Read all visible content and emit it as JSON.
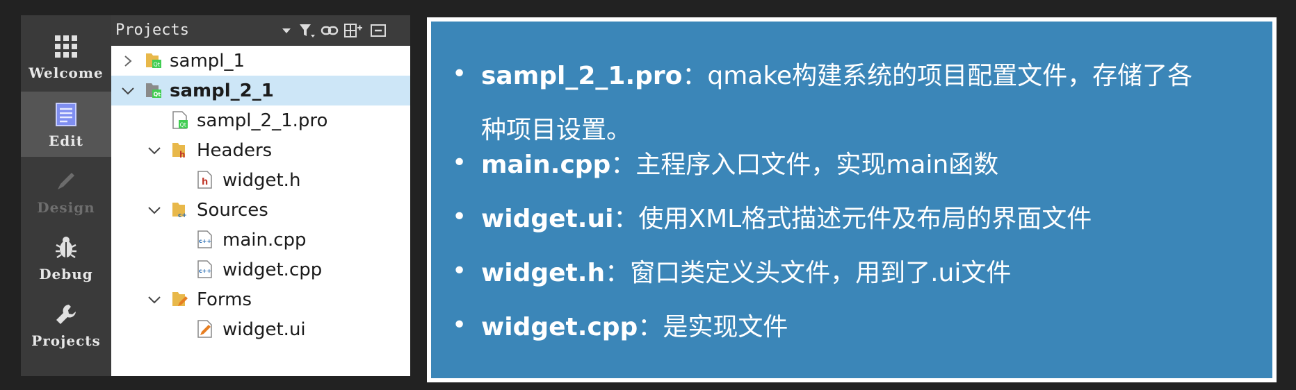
{
  "modes": [
    {
      "label": "Welcome",
      "icon": "grid-icon",
      "state": "normal"
    },
    {
      "label": "Edit",
      "icon": "edit-document-icon",
      "state": "active"
    },
    {
      "label": "Design",
      "icon": "pencil-icon",
      "state": "disabled"
    },
    {
      "label": "Debug",
      "icon": "bug-icon",
      "state": "normal"
    },
    {
      "label": "Projects",
      "icon": "wrench-icon",
      "state": "normal"
    }
  ],
  "projects_panel": {
    "title": "Projects",
    "buttons": [
      "dropdown-icon",
      "filter-icon",
      "link-icon",
      "split-icon",
      "close-panel-icon"
    ],
    "tree": [
      {
        "label": "sampl_1",
        "depth": 0,
        "arrow": "right",
        "icon": "qt-project-folder-icon",
        "selected": false,
        "bold": false
      },
      {
        "label": "sampl_2_1",
        "depth": 0,
        "arrow": "down",
        "icon": "qt-project-folder-icon",
        "selected": true,
        "bold": true
      },
      {
        "label": "sampl_2_1.pro",
        "depth": 1,
        "arrow": "none",
        "icon": "pro-file-icon",
        "selected": false,
        "bold": false
      },
      {
        "label": "Headers",
        "depth": 1,
        "arrow": "down",
        "icon": "headers-folder-icon",
        "selected": false,
        "bold": false
      },
      {
        "label": "widget.h",
        "depth": 2,
        "arrow": "none",
        "icon": "header-file-icon",
        "selected": false,
        "bold": false
      },
      {
        "label": "Sources",
        "depth": 1,
        "arrow": "down",
        "icon": "sources-folder-icon",
        "selected": false,
        "bold": false
      },
      {
        "label": "main.cpp",
        "depth": 2,
        "arrow": "none",
        "icon": "cpp-file-icon",
        "selected": false,
        "bold": false
      },
      {
        "label": "widget.cpp",
        "depth": 2,
        "arrow": "none",
        "icon": "cpp-file-icon",
        "selected": false,
        "bold": false
      },
      {
        "label": "Forms",
        "depth": 1,
        "arrow": "down",
        "icon": "forms-folder-icon",
        "selected": false,
        "bold": false
      },
      {
        "label": "widget.ui",
        "depth": 2,
        "arrow": "none",
        "icon": "ui-file-icon",
        "selected": false,
        "bold": false
      }
    ]
  },
  "slide": {
    "bullets": [
      {
        "term": "sampl_2_1.pro",
        "sep": "：",
        "desc_line1": "qmake构建系统的项目配置文件，存储了各",
        "desc_line2": "种项目设置。"
      },
      {
        "term": "main.cpp",
        "sep": "：",
        "desc_line1": "主程序入口文件，实现main函数",
        "desc_line2": ""
      },
      {
        "term": "widget.ui",
        "sep": "：",
        "desc_line1": "使用XML格式描述元件及布局的界面文件",
        "desc_line2": ""
      },
      {
        "term": "widget.h",
        "sep": "：",
        "desc_line1": "窗口类定义头文件，用到了.ui文件",
        "desc_line2": ""
      },
      {
        "term": "widget.cpp",
        "sep": "：",
        "desc_line1": "是实现文件",
        "desc_line2": ""
      }
    ],
    "bullet_char": "•"
  },
  "colors": {
    "slide_bg": "#3b86b8",
    "selection": "#cde6f7",
    "modebar_bg": "#3a3a3a"
  }
}
